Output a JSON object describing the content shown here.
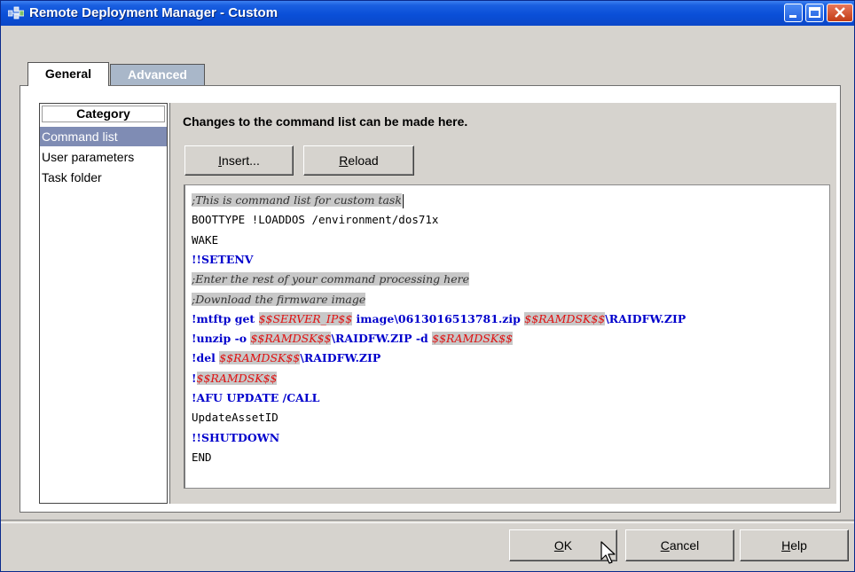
{
  "window": {
    "title": "Remote Deployment Manager - Custom",
    "title_bar_color": "#0b4fd8",
    "controls": [
      "minimize-icon",
      "maximize-icon",
      "close-icon"
    ]
  },
  "tabs": [
    {
      "label": "General",
      "active": true
    },
    {
      "label": "Advanced",
      "active": false
    }
  ],
  "category": {
    "header": "Category",
    "items": [
      {
        "label": "Command list",
        "selected": true
      },
      {
        "label": "User parameters",
        "selected": false
      },
      {
        "label": "Task folder",
        "selected": false
      }
    ]
  },
  "content": {
    "description": "Changes to the command list can be made here.",
    "insert_button": {
      "pre": "",
      "key": "I",
      "post": "nsert..."
    },
    "reload_button": {
      "pre": "",
      "key": "R",
      "post": "eload"
    }
  },
  "editor": {
    "lines": [
      [
        {
          "t": ";This is command list for custom task",
          "s": "comment"
        }
      ],
      [
        {
          "t": "BOOTTYPE !LOADDOS /environment/dos71x",
          "s": "plain"
        }
      ],
      [
        {
          "t": "WAKE",
          "s": "plain"
        }
      ],
      [
        {
          "t": "!!SETENV",
          "s": "cmd"
        }
      ],
      [
        {
          "t": ";Enter the rest of your command processing here",
          "s": "comment"
        }
      ],
      [
        {
          "t": ";Download the firmware image",
          "s": "comment"
        }
      ],
      [
        {
          "t": "!mtftp get ",
          "s": "cmd"
        },
        {
          "t": "$$SERVER_IP$$",
          "s": "var"
        },
        {
          "t": " image\\0613016513781.zip ",
          "s": "cmd"
        },
        {
          "t": "$$RAMDSK$$",
          "s": "var"
        },
        {
          "t": "\\RAIDFW.ZIP",
          "s": "cmd"
        }
      ],
      [
        {
          "t": "!unzip -o ",
          "s": "cmd"
        },
        {
          "t": "$$RAMDSK$$",
          "s": "var"
        },
        {
          "t": "\\RAIDFW.ZIP -d ",
          "s": "cmd"
        },
        {
          "t": "$$RAMDSK$$",
          "s": "var"
        }
      ],
      [
        {
          "t": "!del ",
          "s": "cmd"
        },
        {
          "t": "$$RAMDSK$$",
          "s": "var"
        },
        {
          "t": "\\RAIDFW.ZIP",
          "s": "cmd"
        }
      ],
      [
        {
          "t": "!",
          "s": "cmd"
        },
        {
          "t": "$$RAMDSK$$",
          "s": "var"
        }
      ],
      [
        {
          "t": "!AFU UPDATE /CALL",
          "s": "cmd"
        }
      ],
      [
        {
          "t": "UpdateAssetID",
          "s": "plain"
        }
      ],
      [
        {
          "t": "!!SHUTDOWN",
          "s": "cmd"
        }
      ],
      [
        {
          "t": "END",
          "s": "plain"
        }
      ]
    ]
  },
  "footer": {
    "ok_button": {
      "pre": "",
      "key": "O",
      "post": "K"
    },
    "cancel_button": {
      "pre": "",
      "key": "C",
      "post": "ancel"
    },
    "help_button": {
      "pre": "",
      "key": "H",
      "post": "elp"
    }
  }
}
